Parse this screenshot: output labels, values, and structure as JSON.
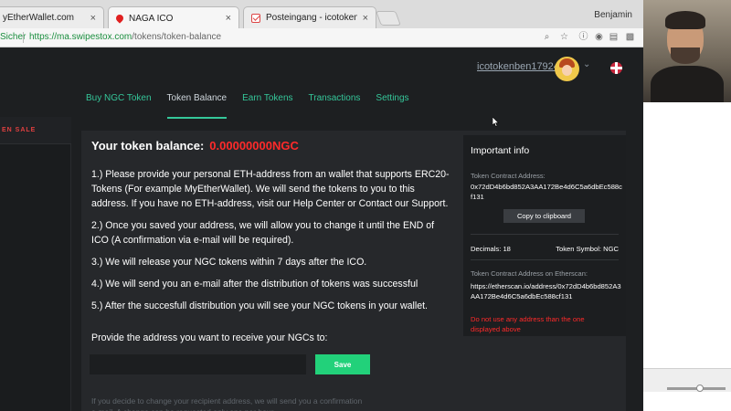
{
  "browser": {
    "tabs": [
      {
        "label": "yEtherWallet.com",
        "close": "×"
      },
      {
        "label": "NAGA ICO",
        "close": "×"
      },
      {
        "label": "Posteingang - icotokenben1@",
        "close": "×"
      }
    ],
    "user": "Benjamin",
    "secure_label": "Sicher",
    "url_host": "https://ma.swipestox.com",
    "url_path": "/tokens/token-balance"
  },
  "header": {
    "account_name": "icotokenben17924"
  },
  "sidebar": {
    "sale_label": "EN SALE"
  },
  "nav": {
    "items": [
      "Buy NGC Token",
      "Token Balance",
      "Earn Tokens",
      "Transactions",
      "Settings"
    ],
    "active": "Token Balance"
  },
  "main": {
    "balance_label": "Your token balance:",
    "balance_value": "0.00000000NGC",
    "steps": [
      "1.) Please provide your personal ETH-address from an wallet that supports ERC20-Tokens (For example MyEtherWallet). We will send the tokens to you to this address. If you have no ETH-address, visit our Help Center or Contact our Support.",
      "2.) Once you saved your address, we will allow you to change it until the END of ICO (A confirmation via e-mail will be required).",
      "3.) We will release your NGC tokens within 7 days after the ICO.",
      "4.) We will send you an e-mail after the distribution of tokens was successful",
      "5.) After the succesfull distribution you will see your NGC tokens in your wallet."
    ],
    "provide_label": "Provide the address you want to receive your NGCs to:",
    "address_value": "",
    "save_label": "Save",
    "note": "If you decide to change your recipient address, we will send you a confirmation e-mail. A change can be requested only one per hour"
  },
  "info": {
    "title": "Important info",
    "contract_label": "Token Contract Address:",
    "contract_value": "0x72dD4b6bd852A3AA172Be4d6C5a6dbEc588cf131",
    "copy_label": "Copy to clipboard",
    "decimals_label": "Decimals: 18",
    "symbol_label": "Token Symbol: NGC",
    "etherscan_label": "Token Contract Address on Etherscan:",
    "etherscan_value": "https://etherscan.io/address/0x72dD4b6bd852A3AA172Be4d6C5a6dbEc588cf131",
    "warning": "Do not use any address than the one displayed above"
  },
  "colors": {
    "accent_green": "#35c79a",
    "save_green": "#22d17a",
    "alert_red": "#ff2a2a",
    "panel_bg": "#26282b",
    "app_bg": "#1d1f21"
  }
}
